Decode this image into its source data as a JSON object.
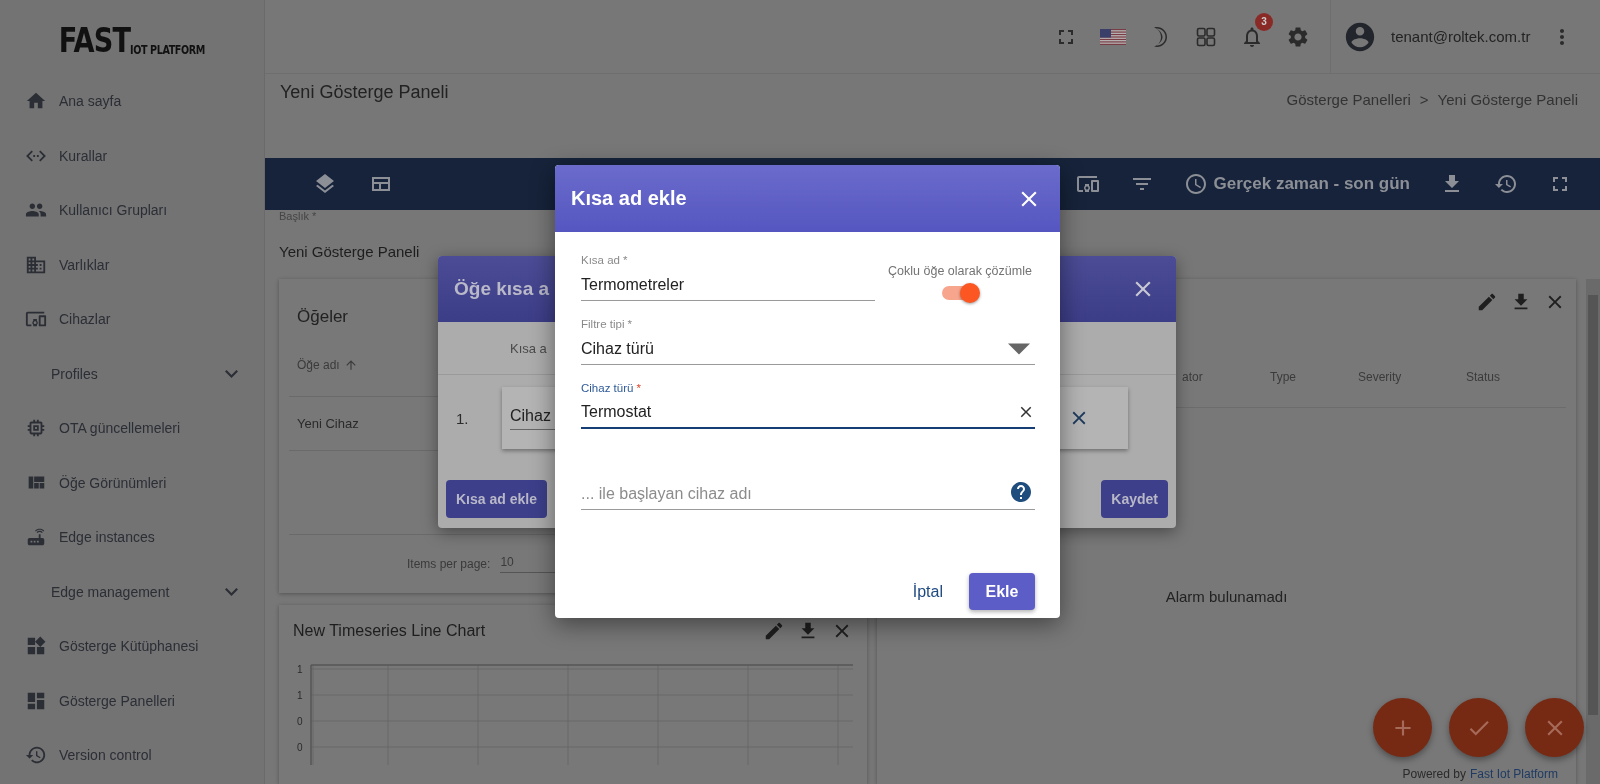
{
  "logo": {
    "main": "FAST",
    "sub": "IOT PLATFORM"
  },
  "sidebar": {
    "items": [
      {
        "label": "Ana sayfa",
        "kind": "link"
      },
      {
        "label": "Kurallar",
        "kind": "link"
      },
      {
        "label": "Kullanıcı Grupları",
        "kind": "link"
      },
      {
        "label": "Varlıklar",
        "kind": "link"
      },
      {
        "label": "Cihazlar",
        "kind": "link"
      },
      {
        "label": "Profiles",
        "kind": "group",
        "expanded": false
      },
      {
        "label": "OTA güncellemeleri",
        "kind": "link"
      },
      {
        "label": "Öğe Görünümleri",
        "kind": "link"
      },
      {
        "label": "Edge instances",
        "kind": "link"
      },
      {
        "label": "Edge management",
        "kind": "group",
        "expanded": false
      },
      {
        "label": "Gösterge Kütüphanesi",
        "kind": "link"
      },
      {
        "label": "Gösterge Panelleri",
        "kind": "link"
      },
      {
        "label": "Version control",
        "kind": "link"
      }
    ]
  },
  "topbar": {
    "notifications": "3",
    "user_email": "tenant@roltek.com.tr"
  },
  "page": {
    "title": "Yeni Gösterge Paneli",
    "breadcrumb": [
      {
        "label": "Gösterge Panelleri"
      },
      {
        "label": "Yeni Gösterge Paneli"
      }
    ],
    "breadcrumb_separator": ">"
  },
  "toolbar": {
    "timewindow": "Gerçek zaman - son gün"
  },
  "title_field": {
    "label": "Başlık *",
    "value": "Yeni Gösterge Paneli"
  },
  "entities_widget": {
    "title": "Öğeler",
    "columns": [
      {
        "label": "Öğe adı",
        "sorted": true
      }
    ],
    "rows": [
      "Yeni Cihaz"
    ],
    "paginator": {
      "label": "Items per page:",
      "value": "10"
    }
  },
  "chart_widget": {
    "title": "New Timeseries Line Chart",
    "y_tick_labels": [
      "1",
      "1",
      "0",
      "0"
    ]
  },
  "alarms_widget": {
    "columns": [
      "ator",
      "Type",
      "Severity",
      "Status"
    ],
    "empty_message": "Alarm bulunamadı"
  },
  "alias_dialog": {
    "title": "Öğe kısa a",
    "column": "Kısa a",
    "rows": [
      {
        "index": "1.",
        "value": "Cihaz"
      }
    ],
    "add_button": "Kısa ad ekle",
    "save_button": "Kaydet"
  },
  "add_alias_dialog": {
    "title": "Kısa ad ekle",
    "fields": [
      {
        "kind": "text",
        "label": "Kısa ad",
        "required_mark": "*",
        "focused": false,
        "value": "Termometreler"
      },
      {
        "kind": "select",
        "label": "Filtre tipi",
        "required_mark": "*",
        "focused": false,
        "value": "Cihaz türü"
      },
      {
        "kind": "autocomplete",
        "label": "Cihaz türü",
        "required_mark": "*",
        "focused": true,
        "value": "Termostat"
      },
      {
        "kind": "help",
        "placeholder": "... ile başlayan cihaz adı"
      }
    ],
    "toggle": {
      "label": "Çoklu öğe olarak çözümle",
      "on": true
    },
    "cancel": "İptal",
    "submit": "Ekle"
  },
  "footer": {
    "prefix": "Powered by",
    "link": "Fast Iot Platform"
  }
}
